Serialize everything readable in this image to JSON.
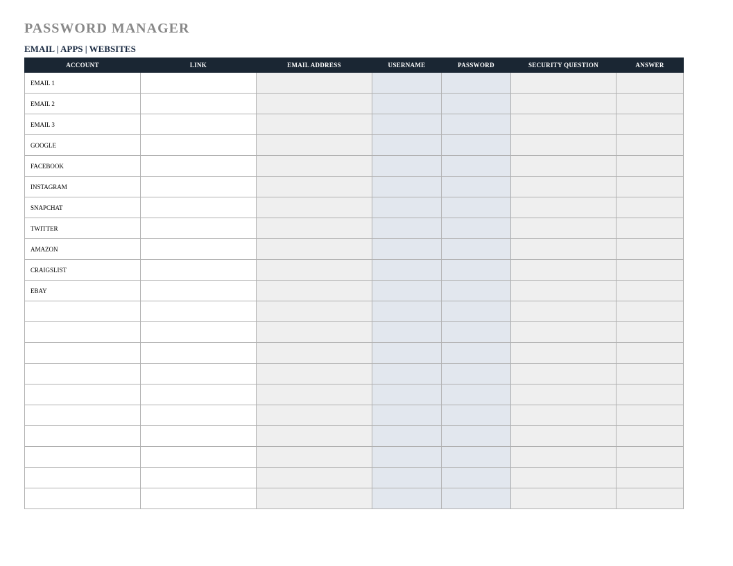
{
  "title": "PASSWORD MANAGER",
  "subtitle": "EMAIL | APPS | WEBSITES",
  "columns": [
    "ACCOUNT",
    "LINK",
    "EMAIL ADDRESS",
    "USERNAME",
    "PASSWORD",
    "SECURITY QUESTION",
    "ANSWER"
  ],
  "rows": [
    {
      "account": "EMAIL 1",
      "link": "",
      "email": "",
      "username": "",
      "password": "",
      "security": "",
      "answer": ""
    },
    {
      "account": "EMAIL 2",
      "link": "",
      "email": "",
      "username": "",
      "password": "",
      "security": "",
      "answer": ""
    },
    {
      "account": "EMAIL 3",
      "link": "",
      "email": "",
      "username": "",
      "password": "",
      "security": "",
      "answer": ""
    },
    {
      "account": "GOOGLE",
      "link": "",
      "email": "",
      "username": "",
      "password": "",
      "security": "",
      "answer": ""
    },
    {
      "account": "FACEBOOK",
      "link": "",
      "email": "",
      "username": "",
      "password": "",
      "security": "",
      "answer": ""
    },
    {
      "account": "INSTAGRAM",
      "link": "",
      "email": "",
      "username": "",
      "password": "",
      "security": "",
      "answer": ""
    },
    {
      "account": "SNAPCHAT",
      "link": "",
      "email": "",
      "username": "",
      "password": "",
      "security": "",
      "answer": ""
    },
    {
      "account": "TWITTER",
      "link": "",
      "email": "",
      "username": "",
      "password": "",
      "security": "",
      "answer": ""
    },
    {
      "account": "AMAZON",
      "link": "",
      "email": "",
      "username": "",
      "password": "",
      "security": "",
      "answer": ""
    },
    {
      "account": "CRAIGSLIST",
      "link": "",
      "email": "",
      "username": "",
      "password": "",
      "security": "",
      "answer": ""
    },
    {
      "account": "EBAY",
      "link": "",
      "email": "",
      "username": "",
      "password": "",
      "security": "",
      "answer": ""
    },
    {
      "account": "",
      "link": "",
      "email": "",
      "username": "",
      "password": "",
      "security": "",
      "answer": ""
    },
    {
      "account": "",
      "link": "",
      "email": "",
      "username": "",
      "password": "",
      "security": "",
      "answer": ""
    },
    {
      "account": "",
      "link": "",
      "email": "",
      "username": "",
      "password": "",
      "security": "",
      "answer": ""
    },
    {
      "account": "",
      "link": "",
      "email": "",
      "username": "",
      "password": "",
      "security": "",
      "answer": ""
    },
    {
      "account": "",
      "link": "",
      "email": "",
      "username": "",
      "password": "",
      "security": "",
      "answer": ""
    },
    {
      "account": "",
      "link": "",
      "email": "",
      "username": "",
      "password": "",
      "security": "",
      "answer": ""
    },
    {
      "account": "",
      "link": "",
      "email": "",
      "username": "",
      "password": "",
      "security": "",
      "answer": ""
    },
    {
      "account": "",
      "link": "",
      "email": "",
      "username": "",
      "password": "",
      "security": "",
      "answer": ""
    },
    {
      "account": "",
      "link": "",
      "email": "",
      "username": "",
      "password": "",
      "security": "",
      "answer": ""
    },
    {
      "account": "",
      "link": "",
      "email": "",
      "username": "",
      "password": "",
      "security": "",
      "answer": ""
    }
  ]
}
